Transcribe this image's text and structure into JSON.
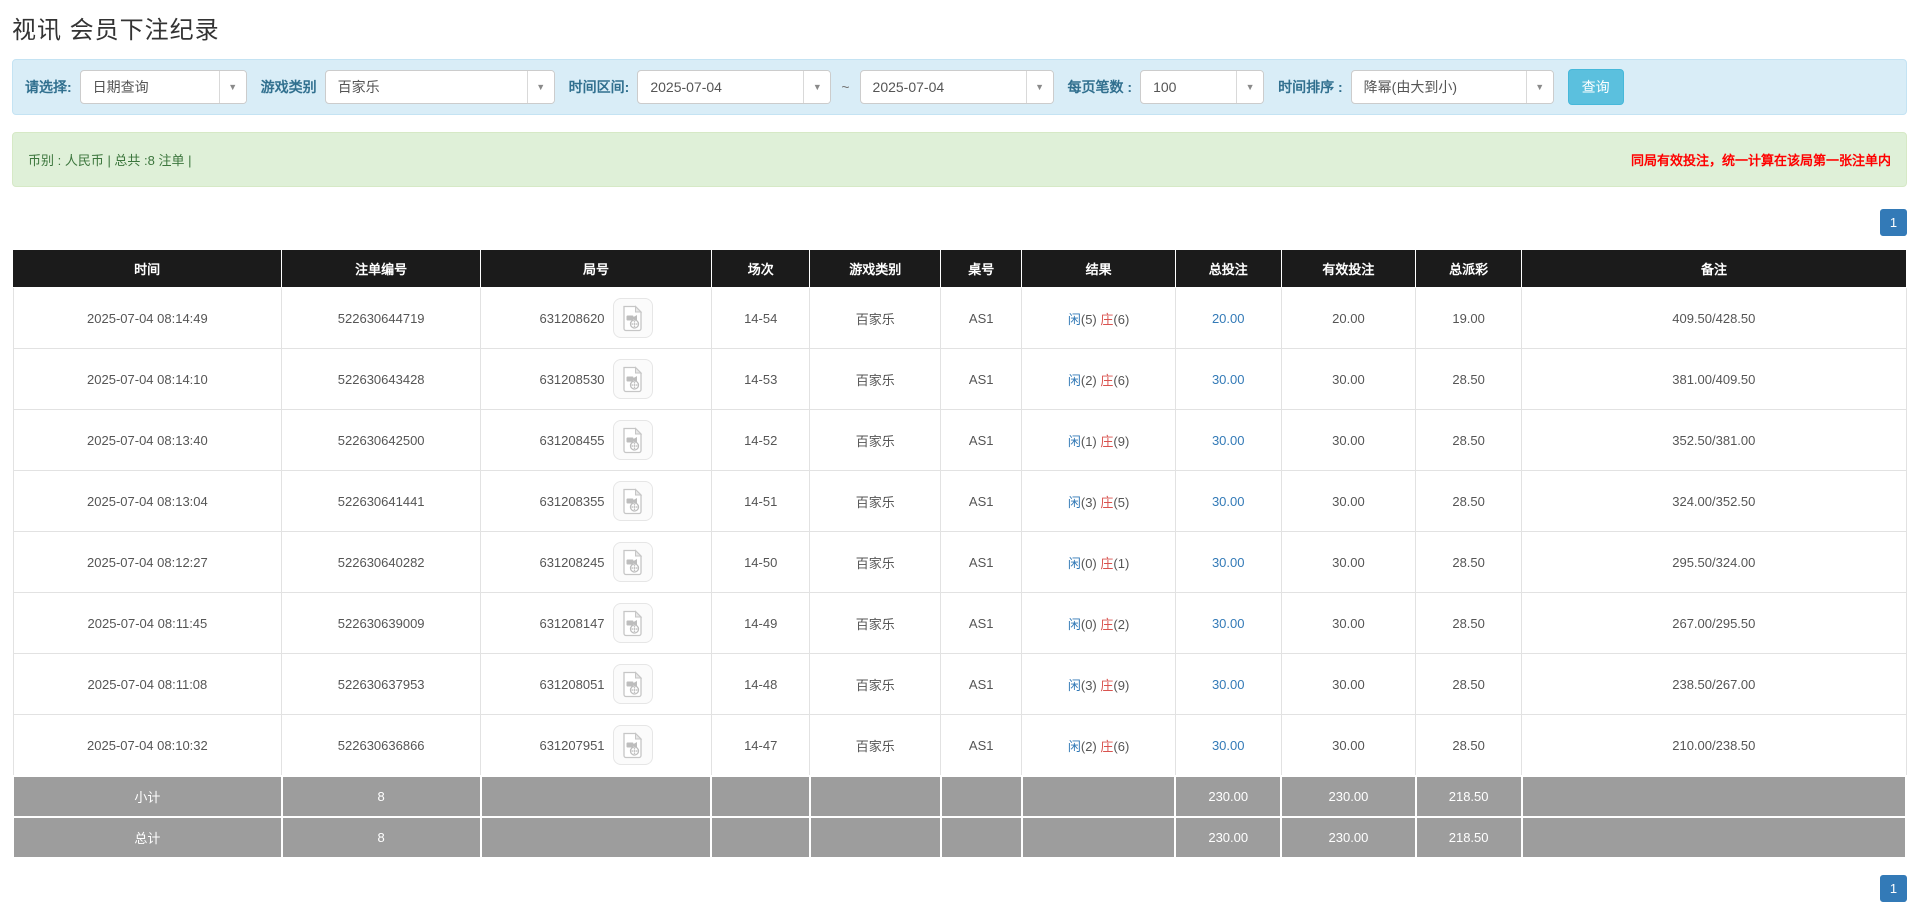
{
  "page": {
    "title": "视讯 会员下注纪录"
  },
  "colors": {
    "filter_bg": "#d9edf7",
    "filter_label": "#31708f",
    "query_button_bg": "#5bc0de",
    "summary_bg": "#dff0d8",
    "summary_text": "#3c763d",
    "notice_red": "#ff0000",
    "table_header_bg": "#1b1b1b",
    "table_footer_bg": "#9d9d9d",
    "link_blue": "#337ab7",
    "player_blue": "#337ab7",
    "banker_red": "#d9534f",
    "pager_active_bg": "#337ab7"
  },
  "filters": {
    "select_label": "请选择:",
    "select_value": "日期查询",
    "game_type_label": "游戏类别",
    "game_type_value": "百家乐",
    "time_range_label": "时间区间:",
    "date_from": "2025-07-04",
    "range_separator": "~",
    "date_to": "2025-07-04",
    "per_page_label": "每页笔数 :",
    "per_page_value": "100",
    "sort_label": "时间排序 :",
    "sort_value": "降幂(由大到小)",
    "query_button_label": "查询",
    "caret_glyph": "▼"
  },
  "summary": {
    "left": "币别 : 人民币 | 总共 :8 注单 |",
    "right": "同局有效投注，统一计算在该局第一张注单内"
  },
  "pagination": {
    "current_page": "1"
  },
  "table": {
    "headers": [
      "时间",
      "注单编号",
      "局号",
      "场次",
      "游戏类别",
      "桌号",
      "结果",
      "总投注",
      "有效投注",
      "总派彩",
      "备注"
    ],
    "rows": [
      {
        "time": "2025-07-04 08:14:49",
        "bet_id": "522630644719",
        "round_id": "631208620",
        "session": "14-54",
        "game": "百家乐",
        "table_no": "AS1",
        "rp": "闲",
        "rpn": "(5)",
        "rb": "庄",
        "rbn": "(6)",
        "total_bet": "20.00",
        "valid_bet": "20.00",
        "payout": "19.00",
        "remark": "409.50/428.50"
      },
      {
        "time": "2025-07-04 08:14:10",
        "bet_id": "522630643428",
        "round_id": "631208530",
        "session": "14-53",
        "game": "百家乐",
        "table_no": "AS1",
        "rp": "闲",
        "rpn": "(2)",
        "rb": "庄",
        "rbn": "(6)",
        "total_bet": "30.00",
        "valid_bet": "30.00",
        "payout": "28.50",
        "remark": "381.00/409.50"
      },
      {
        "time": "2025-07-04 08:13:40",
        "bet_id": "522630642500",
        "round_id": "631208455",
        "session": "14-52",
        "game": "百家乐",
        "table_no": "AS1",
        "rp": "闲",
        "rpn": "(1)",
        "rb": "庄",
        "rbn": "(9)",
        "total_bet": "30.00",
        "valid_bet": "30.00",
        "payout": "28.50",
        "remark": "352.50/381.00"
      },
      {
        "time": "2025-07-04 08:13:04",
        "bet_id": "522630641441",
        "round_id": "631208355",
        "session": "14-51",
        "game": "百家乐",
        "table_no": "AS1",
        "rp": "闲",
        "rpn": "(3)",
        "rb": "庄",
        "rbn": "(5)",
        "total_bet": "30.00",
        "valid_bet": "30.00",
        "payout": "28.50",
        "remark": "324.00/352.50"
      },
      {
        "time": "2025-07-04 08:12:27",
        "bet_id": "522630640282",
        "round_id": "631208245",
        "session": "14-50",
        "game": "百家乐",
        "table_no": "AS1",
        "rp": "闲",
        "rpn": "(0)",
        "rb": "庄",
        "rbn": "(1)",
        "total_bet": "30.00",
        "valid_bet": "30.00",
        "payout": "28.50",
        "remark": "295.50/324.00"
      },
      {
        "time": "2025-07-04 08:11:45",
        "bet_id": "522630639009",
        "round_id": "631208147",
        "session": "14-49",
        "game": "百家乐",
        "table_no": "AS1",
        "rp": "闲",
        "rpn": "(0)",
        "rb": "庄",
        "rbn": "(2)",
        "total_bet": "30.00",
        "valid_bet": "30.00",
        "payout": "28.50",
        "remark": "267.00/295.50"
      },
      {
        "time": "2025-07-04 08:11:08",
        "bet_id": "522630637953",
        "round_id": "631208051",
        "session": "14-48",
        "game": "百家乐",
        "table_no": "AS1",
        "rp": "闲",
        "rpn": "(3)",
        "rb": "庄",
        "rbn": "(9)",
        "total_bet": "30.00",
        "valid_bet": "30.00",
        "payout": "28.50",
        "remark": "238.50/267.00"
      },
      {
        "time": "2025-07-04 08:10:32",
        "bet_id": "522630636866",
        "round_id": "631207951",
        "session": "14-47",
        "game": "百家乐",
        "table_no": "AS1",
        "rp": "闲",
        "rpn": "(2)",
        "rb": "庄",
        "rbn": "(6)",
        "total_bet": "30.00",
        "valid_bet": "30.00",
        "payout": "28.50",
        "remark": "210.00/238.50"
      }
    ],
    "subtotal": {
      "label": "小计",
      "count": "8",
      "total_bet": "230.00",
      "valid_bet": "230.00",
      "payout": "218.50"
    },
    "total": {
      "label": "总计",
      "count": "8",
      "total_bet": "230.00",
      "valid_bet": "230.00",
      "payout": "218.50"
    }
  },
  "icons": {
    "video_file_icon": "video-replay",
    "caret_down_icon": "caret-down"
  }
}
